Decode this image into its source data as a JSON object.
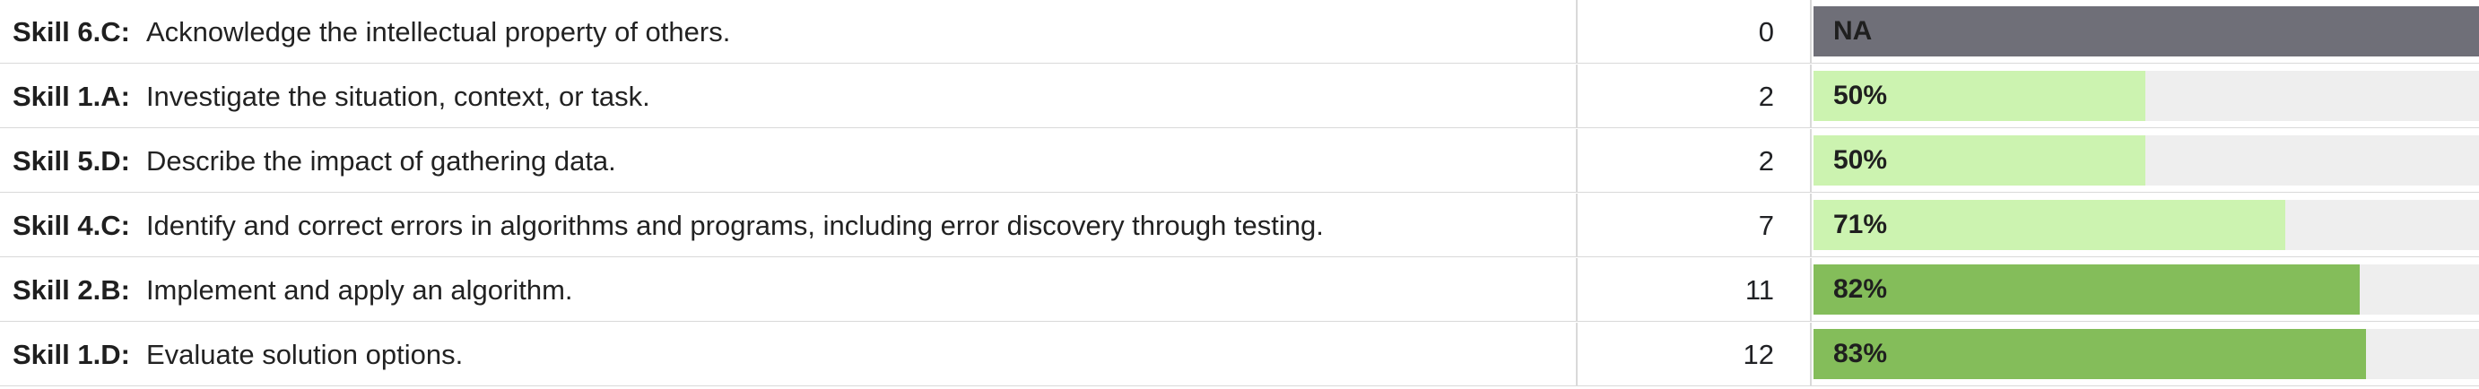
{
  "rows": [
    {
      "code": "Skill 6.C:",
      "description": "Acknowledge the intellectual property of others.",
      "count": "0",
      "score_label": "NA",
      "score_fraction": null,
      "bar_color": "#6f6f78"
    },
    {
      "code": "Skill 1.A:",
      "description": "Investigate the situation, context, or task.",
      "count": "2",
      "score_label": "50%",
      "score_fraction": 0.5,
      "bar_color": "#ccf3b0"
    },
    {
      "code": "Skill 5.D:",
      "description": "Describe the impact of gathering data.",
      "count": "2",
      "score_label": "50%",
      "score_fraction": 0.5,
      "bar_color": "#ccf3b0"
    },
    {
      "code": "Skill 4.C:",
      "description": "Identify and correct errors in algorithms and programs, including error discovery through testing.",
      "count": "7",
      "score_label": "71%",
      "score_fraction": 0.71,
      "bar_color": "#ccf3b0"
    },
    {
      "code": "Skill 2.B:",
      "description": "Implement and apply an algorithm.",
      "count": "11",
      "score_label": "82%",
      "score_fraction": 0.82,
      "bar_color": "#84bd5a"
    },
    {
      "code": "Skill 1.D:",
      "description": "Evaluate solution options.",
      "count": "12",
      "score_label": "83%",
      "score_fraction": 0.83,
      "bar_color": "#84bd5a"
    }
  ]
}
